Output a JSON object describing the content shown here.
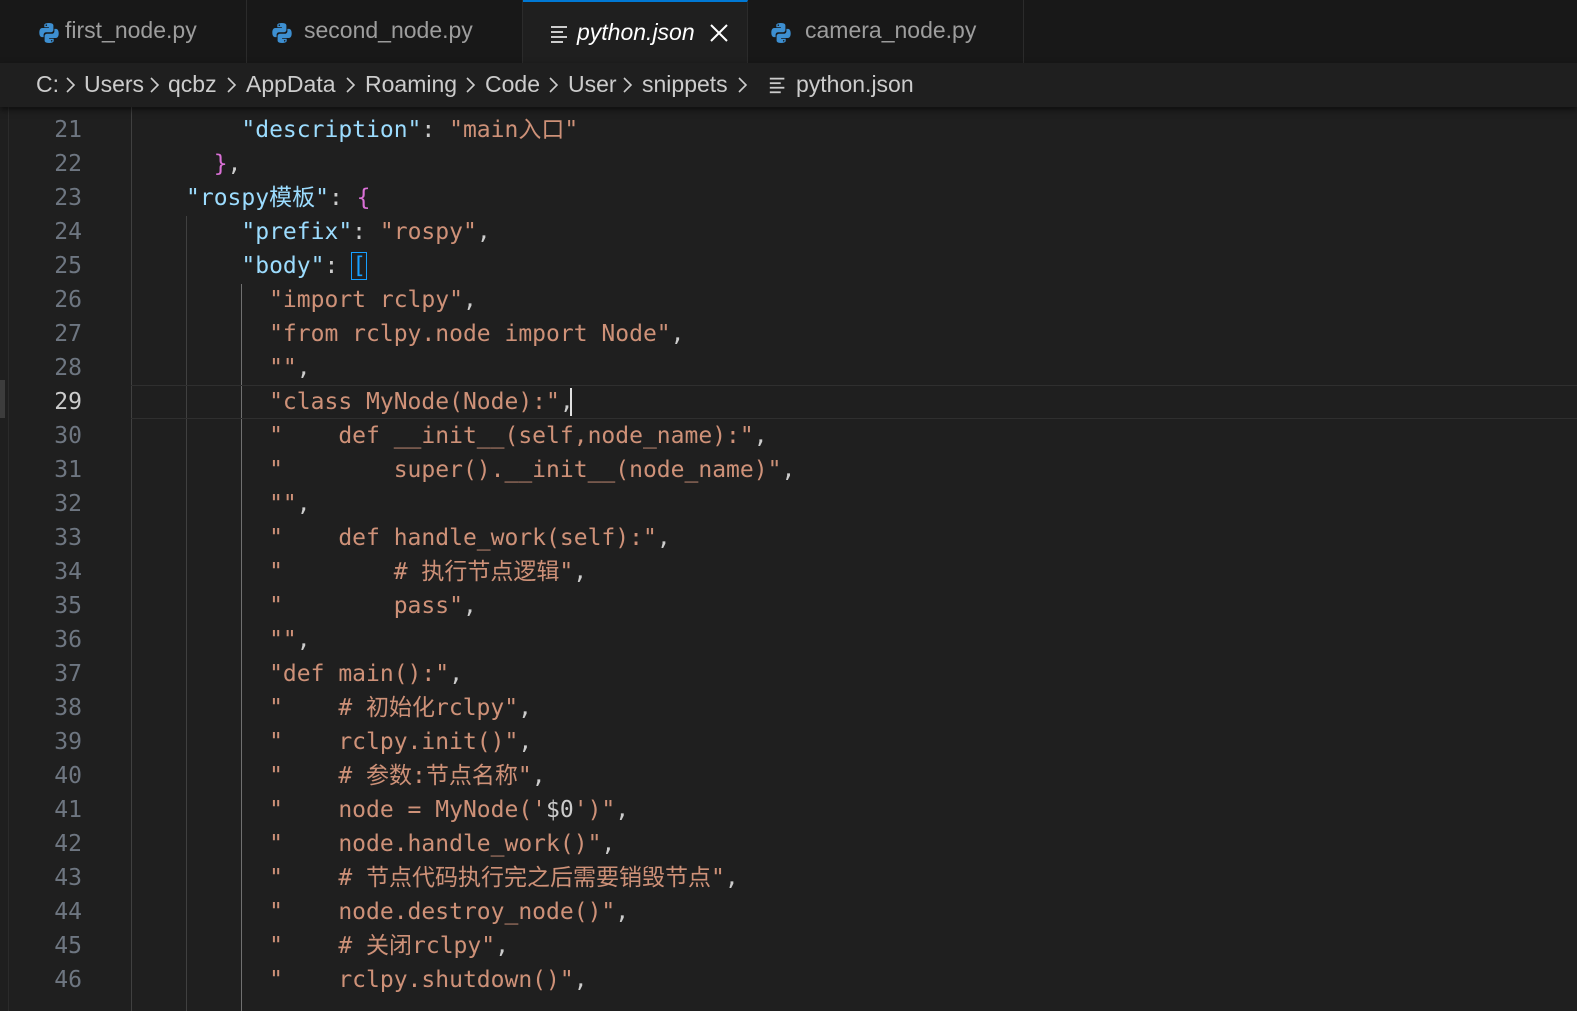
{
  "tabs": [
    {
      "label": "first_node.py",
      "icon": "python-icon"
    },
    {
      "label": "second_node.py",
      "icon": "python-icon"
    },
    {
      "label": "python.json",
      "icon": "json-file-icon",
      "active": true
    },
    {
      "label": "camera_node.py",
      "icon": "python-icon"
    }
  ],
  "breadcrumb": [
    "C:",
    "Users",
    "qcbz",
    "AppData",
    "Roaming",
    "Code",
    "User",
    "snippets",
    "python.json"
  ],
  "colors": {
    "key": "#9cdcfe",
    "string": "#ce9178",
    "punctuation": "#cccccc",
    "brace": "#da70d6",
    "bracket": "#179fff",
    "accent": "#0078d4"
  },
  "editor": {
    "current_line": 29,
    "lines": [
      {
        "n": "21",
        "t": [
          [
            "    \"description\"",
            "k"
          ],
          [
            ": ",
            "p"
          ],
          [
            "\"main入口\"",
            "s"
          ]
        ]
      },
      {
        "n": "22",
        "t": [
          [
            "  }",
            "b1"
          ],
          [
            ",",
            "p"
          ]
        ]
      },
      {
        "n": "23",
        "t": [
          [
            "\"rospy模板\"",
            "k"
          ],
          [
            ": ",
            "p"
          ],
          [
            "{",
            "b1"
          ]
        ]
      },
      {
        "n": "24",
        "t": [
          [
            "    \"prefix\"",
            "k"
          ],
          [
            ": ",
            "p"
          ],
          [
            "\"rospy\"",
            "s"
          ],
          [
            ",",
            "p"
          ]
        ]
      },
      {
        "n": "25",
        "t": [
          [
            "    \"body\"",
            "k"
          ],
          [
            ": ",
            "p"
          ],
          [
            "[",
            "b2"
          ]
        ]
      },
      {
        "n": "26",
        "t": [
          [
            "      \"import rclpy\"",
            "s"
          ],
          [
            ",",
            "p"
          ]
        ]
      },
      {
        "n": "27",
        "t": [
          [
            "      \"from rclpy.node import Node\"",
            "s"
          ],
          [
            ",",
            "p"
          ]
        ]
      },
      {
        "n": "28",
        "t": [
          [
            "      \"\"",
            "s"
          ],
          [
            ",",
            "p"
          ]
        ]
      },
      {
        "n": "29",
        "t": [
          [
            "      \"class MyNode(Node):\"",
            "s"
          ],
          [
            ",",
            "p"
          ]
        ]
      },
      {
        "n": "30",
        "t": [
          [
            "      \"    def __init__(self,node_name):\"",
            "s"
          ],
          [
            ",",
            "p"
          ]
        ]
      },
      {
        "n": "31",
        "t": [
          [
            "      \"        super().__init__(node_name)\"",
            "s"
          ],
          [
            ",",
            "p"
          ]
        ]
      },
      {
        "n": "32",
        "t": [
          [
            "      \"\"",
            "s"
          ],
          [
            ",",
            "p"
          ]
        ]
      },
      {
        "n": "33",
        "t": [
          [
            "      \"    def handle_work(self):\"",
            "s"
          ],
          [
            ",",
            "p"
          ]
        ]
      },
      {
        "n": "34",
        "t": [
          [
            "      \"        # 执行节点逻辑\"",
            "s"
          ],
          [
            ",",
            "p"
          ]
        ]
      },
      {
        "n": "35",
        "t": [
          [
            "      \"        pass\"",
            "s"
          ],
          [
            ",",
            "p"
          ]
        ]
      },
      {
        "n": "36",
        "t": [
          [
            "      \"\"",
            "s"
          ],
          [
            ",",
            "p"
          ]
        ]
      },
      {
        "n": "37",
        "t": [
          [
            "      \"def main():\"",
            "s"
          ],
          [
            ",",
            "p"
          ]
        ]
      },
      {
        "n": "38",
        "t": [
          [
            "      \"    # 初始化rclpy\"",
            "s"
          ],
          [
            ",",
            "p"
          ]
        ]
      },
      {
        "n": "39",
        "t": [
          [
            "      \"    rclpy.init()\"",
            "s"
          ],
          [
            ",",
            "p"
          ]
        ]
      },
      {
        "n": "40",
        "t": [
          [
            "      \"    # 参数:节点名称\"",
            "s"
          ],
          [
            ",",
            "p"
          ]
        ]
      },
      {
        "n": "41",
        "t": [
          [
            "      \"    node = MyNode('",
            "s"
          ],
          [
            "$0",
            "p"
          ],
          [
            "')\"",
            "s"
          ],
          [
            ",",
            "p"
          ]
        ]
      },
      {
        "n": "42",
        "t": [
          [
            "      \"    node.handle_work()\"",
            "s"
          ],
          [
            ",",
            "p"
          ]
        ]
      },
      {
        "n": "43",
        "t": [
          [
            "      \"    # 节点代码执行完之后需要销毁节点\"",
            "s"
          ],
          [
            ",",
            "p"
          ]
        ]
      },
      {
        "n": "44",
        "t": [
          [
            "      \"    node.destroy_node()\"",
            "s"
          ],
          [
            ",",
            "p"
          ]
        ]
      },
      {
        "n": "45",
        "t": [
          [
            "      \"    # 关闭rclpy\"",
            "s"
          ],
          [
            ",",
            "p"
          ]
        ]
      },
      {
        "n": "46",
        "t": [
          [
            "      \"    rclpy.shutdown()\"",
            "s"
          ],
          [
            ",",
            "p"
          ]
        ]
      }
    ]
  }
}
